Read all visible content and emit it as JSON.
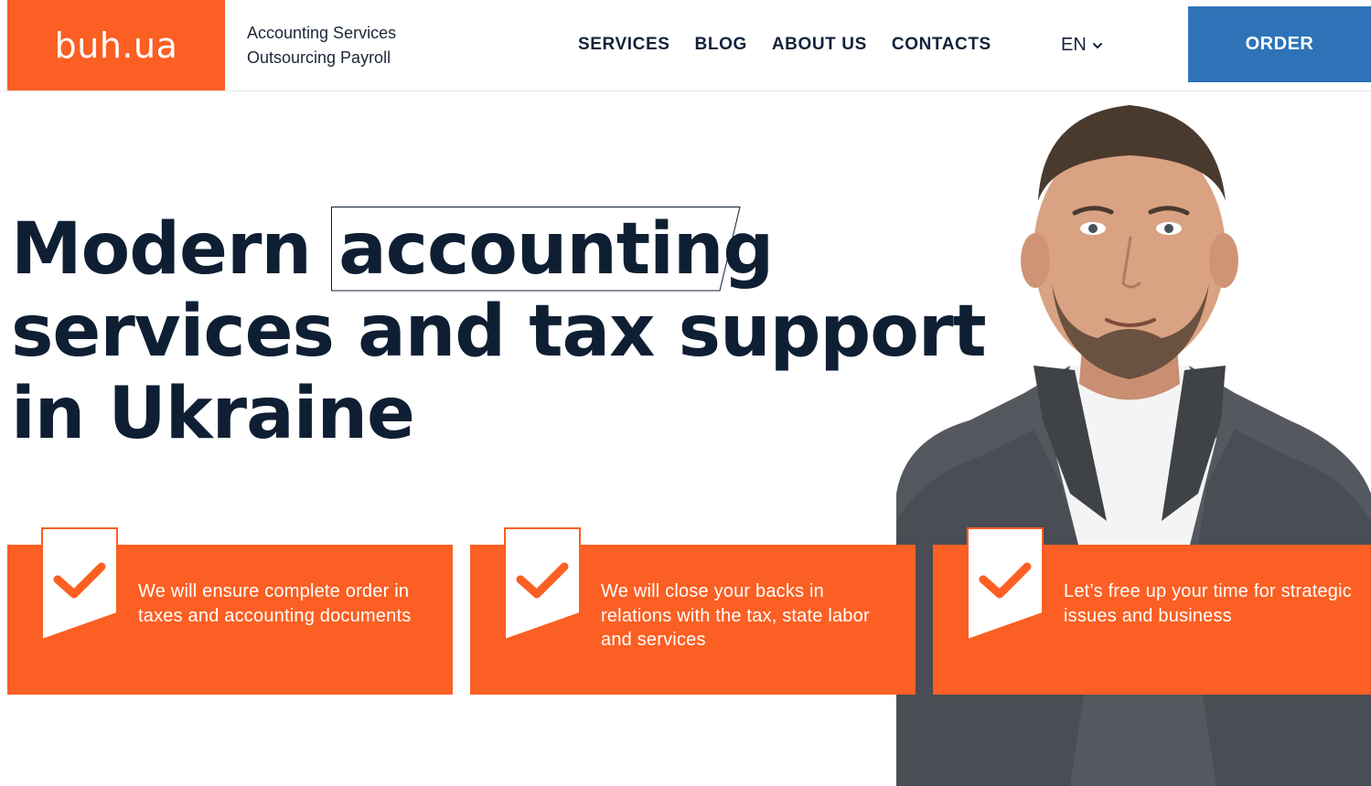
{
  "header": {
    "logo_text": "buh.ua",
    "tagline_line1": "Accounting Services",
    "tagline_line2": "Outsourcing Payroll",
    "nav": [
      "SERVICES",
      "BLOG",
      "ABOUT US",
      "CONTACTS"
    ],
    "language": "EN",
    "order_label": "ORDER"
  },
  "hero": {
    "line1_start": "Modern ",
    "line1_framed": "accounting",
    "line2": "services and tax support",
    "line3": "in Ukraine"
  },
  "features": [
    {
      "text": "We will ensure complete order in taxes and accounting documents"
    },
    {
      "text": "We will close your backs in relations with the tax, state labor and services"
    },
    {
      "text": "Let’s free up your time for strategic issues and business"
    }
  ],
  "colors": {
    "brand_orange": "#fb5f23",
    "order_blue": "#2e73b8",
    "text_dark": "#0f1f33"
  },
  "icons": [
    "chevron-down-icon",
    "checkmark-icon"
  ]
}
